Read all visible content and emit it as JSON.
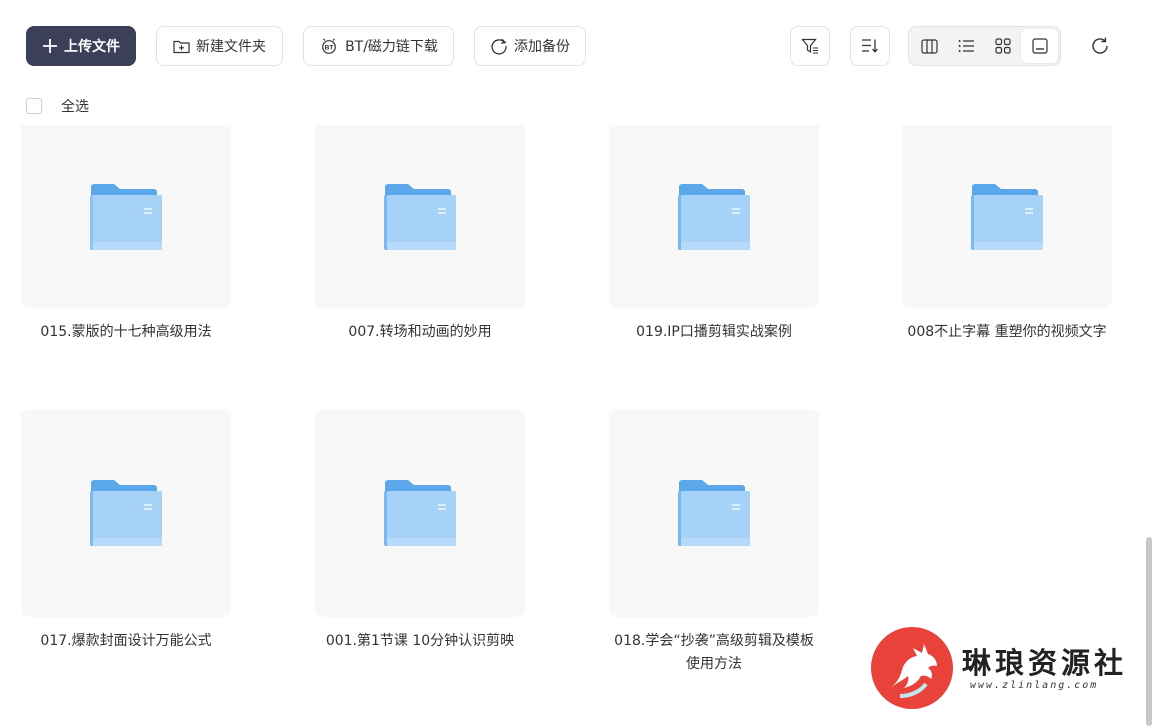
{
  "toolbar": {
    "upload_label": "上传文件",
    "new_folder_label": "新建文件夹",
    "bt_label": "BT/磁力链下载",
    "backup_label": "添加备份"
  },
  "select_all": {
    "label": "全选"
  },
  "files": [
    {
      "name": "015.蒙版的十七种高级用法"
    },
    {
      "name": "007.转场和动画的妙用"
    },
    {
      "name": "019.IP口播剪辑实战案例"
    },
    {
      "name": "008不止字幕 重塑你的视频文字"
    },
    {
      "name": "017.爆款封面设计万能公式"
    },
    {
      "name": "001.第1节课 10分钟认识剪映"
    },
    {
      "name": "018.学会“抄袭”高级剪辑及模板使用方法"
    }
  ],
  "watermark": {
    "title": "琳琅资源社",
    "url": "www.zlinlang.com"
  },
  "colors": {
    "primary": "#3b3f58",
    "folder": "#7cb8f0",
    "tile_bg": "#f8f8f9",
    "logo_red": "#e8423b"
  }
}
